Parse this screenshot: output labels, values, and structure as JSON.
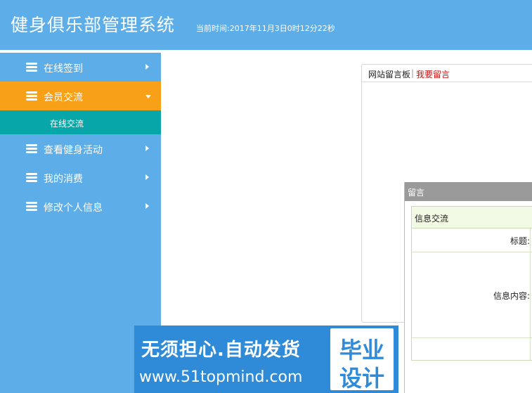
{
  "header": {
    "title": "健身俱乐部管理系统",
    "time": "当前时间:2017年11月3日0时12分22秒"
  },
  "sidebar": {
    "items": [
      {
        "label": "在线签到",
        "icon": "stack-icon"
      },
      {
        "label": "会员交流",
        "icon": "stack-icon",
        "active": true,
        "children": [
          {
            "label": "在线交流"
          }
        ]
      },
      {
        "label": "查看健身活动",
        "icon": "stack-icon"
      },
      {
        "label": "我的消费",
        "icon": "stack-icon"
      },
      {
        "label": "修改个人信息",
        "icon": "stack-icon"
      }
    ]
  },
  "board": {
    "title": "网站留言板",
    "separator": "|",
    "post_link": "我要留言"
  },
  "dialog": {
    "title": "留言",
    "form_title": "信息交流",
    "field_title": "标题:",
    "field_content": "信息内容:"
  },
  "watermark": {
    "slogan": "无须担心.自动发货",
    "url": "www.51topmind.com",
    "seal_line1": "毕业",
    "seal_line2": "设计"
  },
  "colors": {
    "header_bg": "#5daee8",
    "active_item": "#f7a018",
    "sub_item": "#06a6a9",
    "link_red": "#cc1010"
  }
}
